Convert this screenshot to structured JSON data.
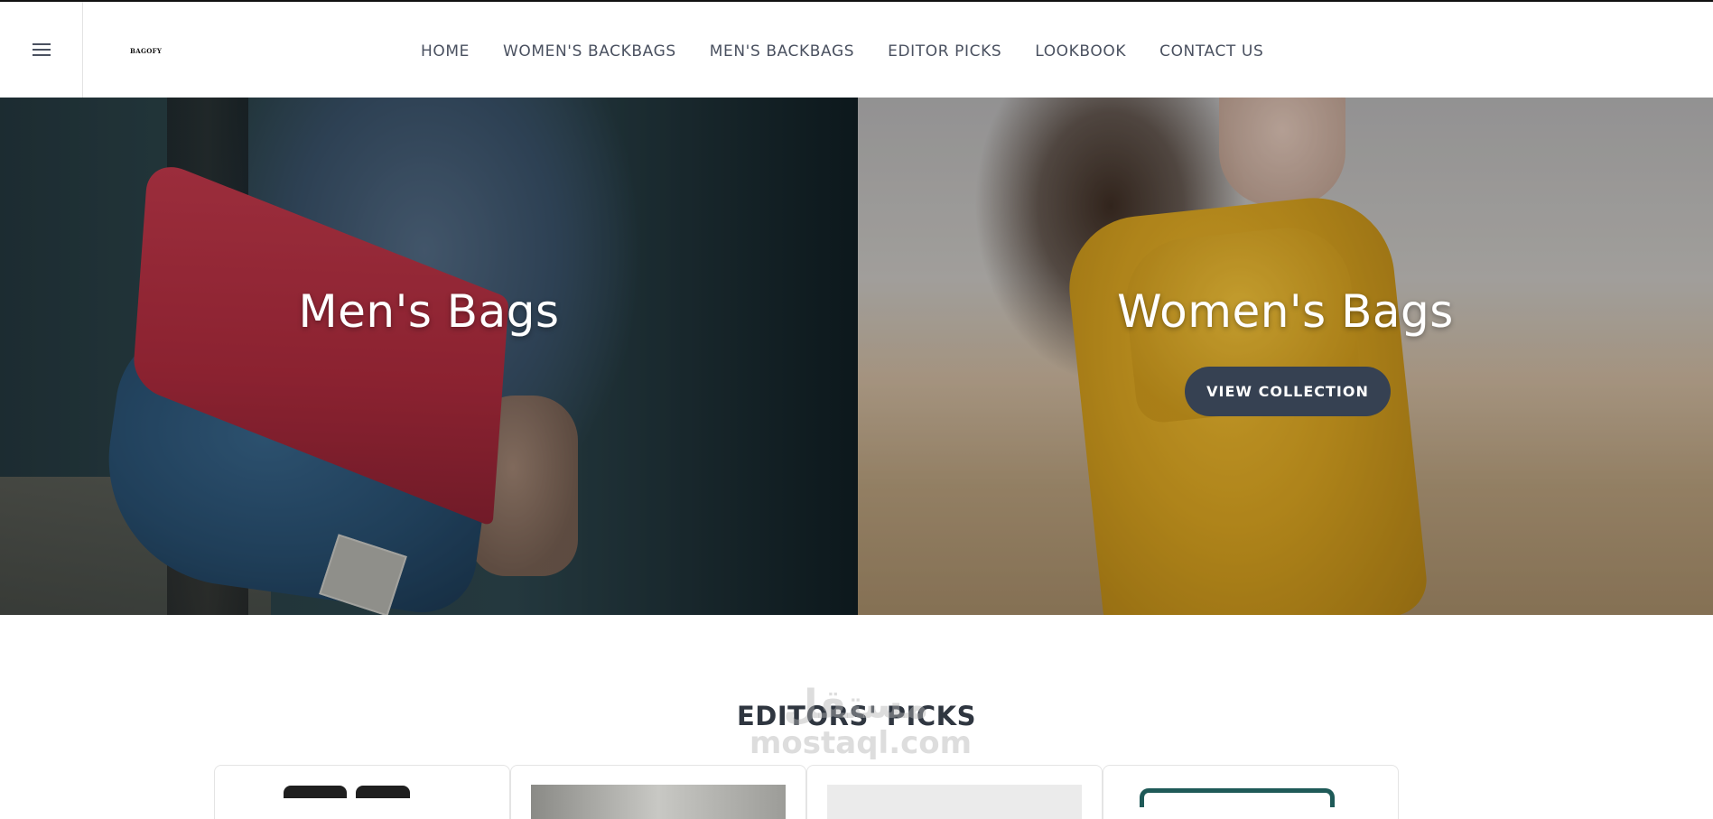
{
  "header": {
    "logo": "BAGOFY",
    "menu_icon": "hamburger-menu-icon",
    "nav": [
      {
        "label": "HOME"
      },
      {
        "label": "WOMEN'S BACKBAGS"
      },
      {
        "label": "MEN'S BACKBAGS"
      },
      {
        "label": "EDITOR PICKS"
      },
      {
        "label": "LOOKBOOK"
      },
      {
        "label": "CONTACT US"
      }
    ]
  },
  "hero": {
    "men": {
      "title": "Men's Bags"
    },
    "women": {
      "title": "Women's Bags",
      "cta": "VIEW COLLECTION"
    }
  },
  "editors": {
    "title": "EDITORS' PICKS"
  },
  "watermark": {
    "arabic": "مستقل",
    "latin": "mostaql.com"
  },
  "colors": {
    "primary": "#364152",
    "text": "#2f3640",
    "nav_text": "#4a5160"
  }
}
